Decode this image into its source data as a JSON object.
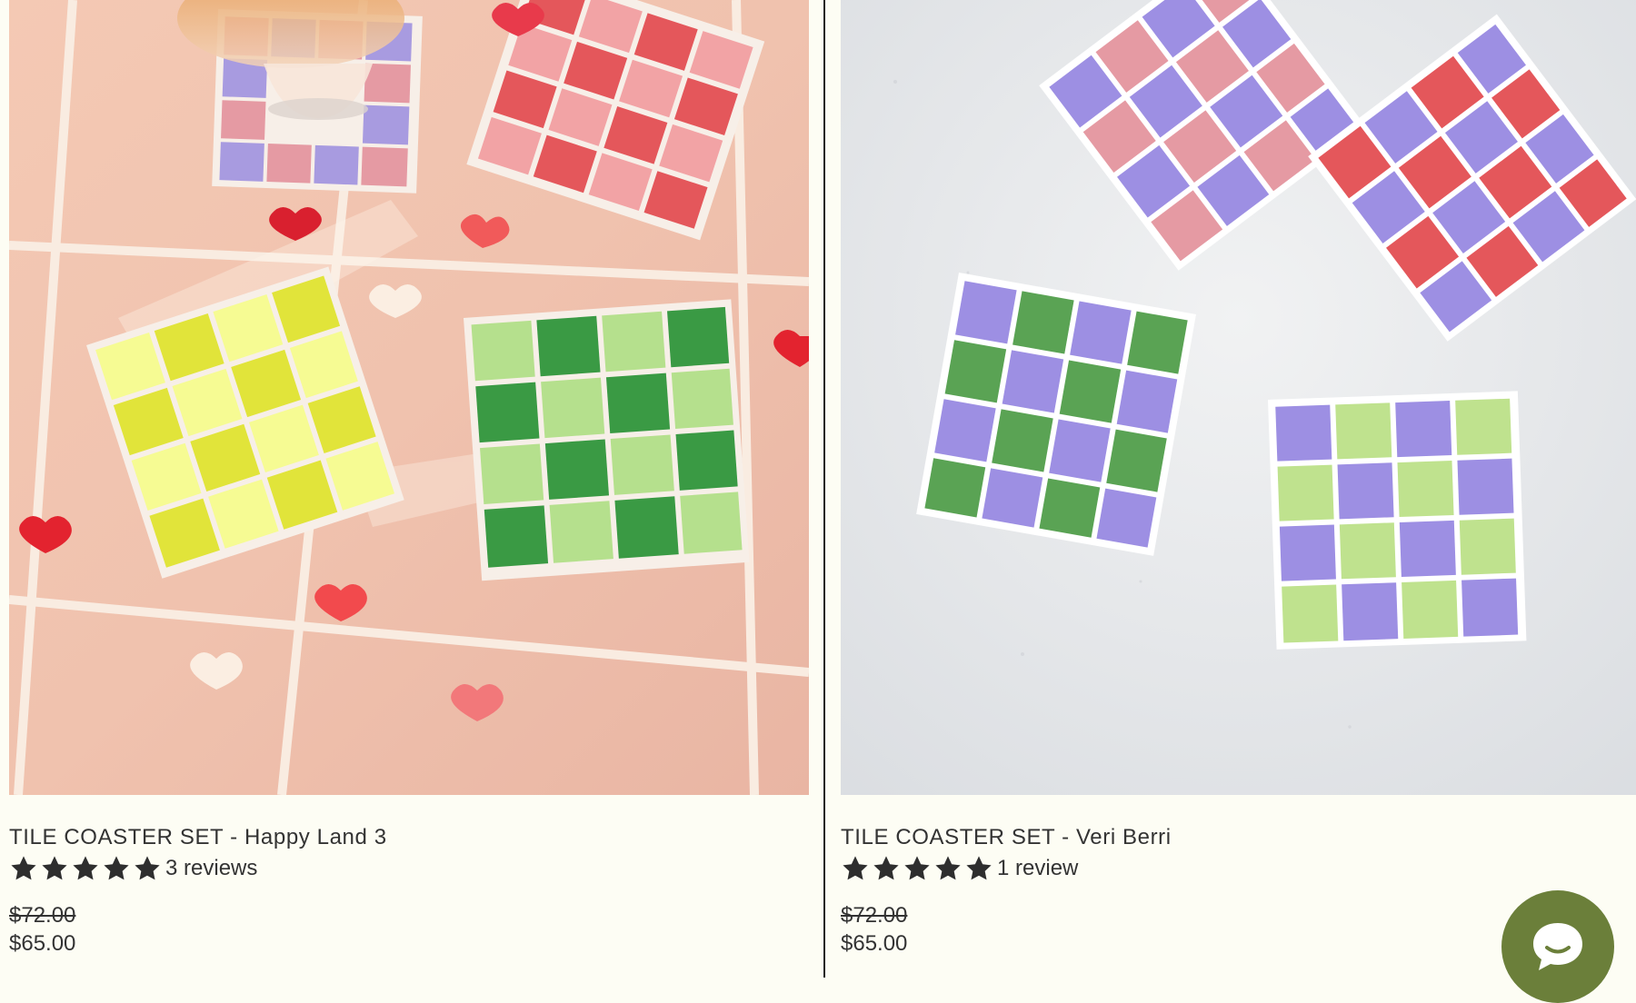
{
  "products": [
    {
      "title": "TILE COASTER SET - Happy Land 3",
      "rating": 5,
      "review_count_text": "3 reviews",
      "compare_price": "$72.00",
      "price": "$65.00",
      "image_icon": "product-photo",
      "palette": [
        "#f7ffa0",
        "#e6ea3e",
        "#3a9a44",
        "#a6d97b",
        "#e2585b",
        "#f2a3a5",
        "#a89be0"
      ]
    },
    {
      "title": "TILE COASTER SET - Veri Berri",
      "rating": 5,
      "review_count_text": "1 review",
      "compare_price": "$72.00",
      "price": "$65.00",
      "image_icon": "product-photo",
      "palette": [
        "#9d8fe3",
        "#e59aa3",
        "#e4575b",
        "#5aa354",
        "#bfe28e"
      ]
    }
  ],
  "chat": {
    "icon": "chat-bubble-icon",
    "color": "#6b7f3a"
  },
  "colors": {
    "background": "#fdfdf4",
    "text": "#333333",
    "divider": "#1f1f1f"
  }
}
